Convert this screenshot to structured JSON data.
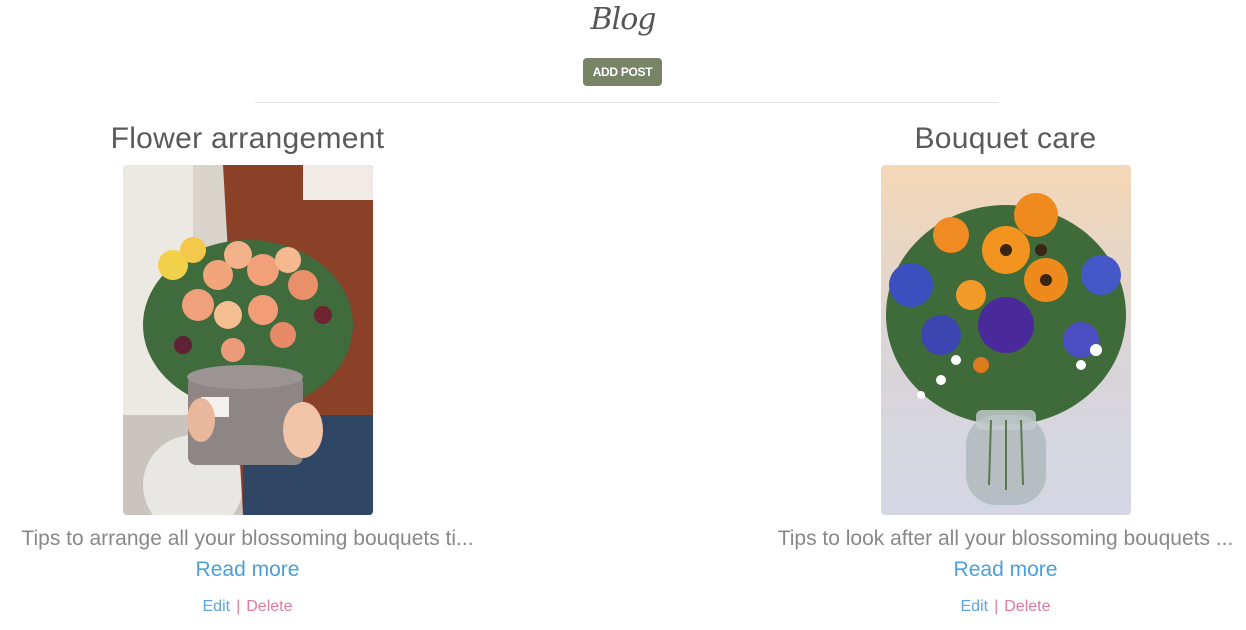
{
  "header": {
    "title": "Blog",
    "add_post_label": "ADD POST"
  },
  "posts": [
    {
      "title": "Flower arrangement",
      "excerpt": "Tips to arrange all your blossoming bouquets ti...",
      "read_more": "Read more",
      "edit_label": "Edit",
      "separator": "|",
      "delete_label": "Delete"
    },
    {
      "title": "Bouquet care",
      "excerpt": "Tips to look after all your blossoming bouquets ...",
      "read_more": "Read more",
      "edit_label": "Edit",
      "separator": "|",
      "delete_label": "Delete"
    }
  ],
  "colors": {
    "accent_button": "#778566",
    "link_blue": "#4a9fdc",
    "delete_pink": "#e07b9a"
  }
}
